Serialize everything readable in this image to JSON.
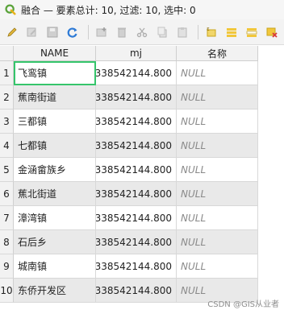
{
  "window": {
    "title": "融合 — 要素总计: 10, 过滤: 10, 选中: 0"
  },
  "toolbar": {
    "icons": [
      "pencil-icon",
      "edit-multiple-icon",
      "save-icon",
      "refresh-icon",
      "add-feature-icon",
      "delete-icon",
      "cut-icon",
      "copy-icon",
      "paste-icon",
      "select-by-expression-icon",
      "select-all-icon",
      "invert-selection-icon",
      "deselect-icon",
      "filter-icon"
    ]
  },
  "table": {
    "columns": [
      "NAME",
      "mj",
      "名称"
    ],
    "rows": [
      {
        "num": "1",
        "name": "飞鸾镇",
        "mj": "338542144.800",
        "mc": "NULL"
      },
      {
        "num": "2",
        "name": "蕉南街道",
        "mj": "338542144.800",
        "mc": "NULL"
      },
      {
        "num": "3",
        "name": "三都镇",
        "mj": "338542144.800",
        "mc": "NULL"
      },
      {
        "num": "4",
        "name": "七都镇",
        "mj": "338542144.800",
        "mc": "NULL"
      },
      {
        "num": "5",
        "name": "金涵畲族乡",
        "mj": "338542144.800",
        "mc": "NULL"
      },
      {
        "num": "6",
        "name": "蕉北街道",
        "mj": "338542144.800",
        "mc": "NULL"
      },
      {
        "num": "7",
        "name": "漳湾镇",
        "mj": "338542144.800",
        "mc": "NULL"
      },
      {
        "num": "8",
        "name": "石后乡",
        "mj": "338542144.800",
        "mc": "NULL"
      },
      {
        "num": "9",
        "name": "城南镇",
        "mj": "338542144.800",
        "mc": "NULL"
      },
      {
        "num": "10",
        "name": "东侨开发区",
        "mj": "338542144.800",
        "mc": "NULL"
      }
    ]
  },
  "watermark": "CSDN @GIS从业者",
  "colors": {
    "selection_outline": "#35c56b",
    "app_icon": "#5aa33a"
  }
}
